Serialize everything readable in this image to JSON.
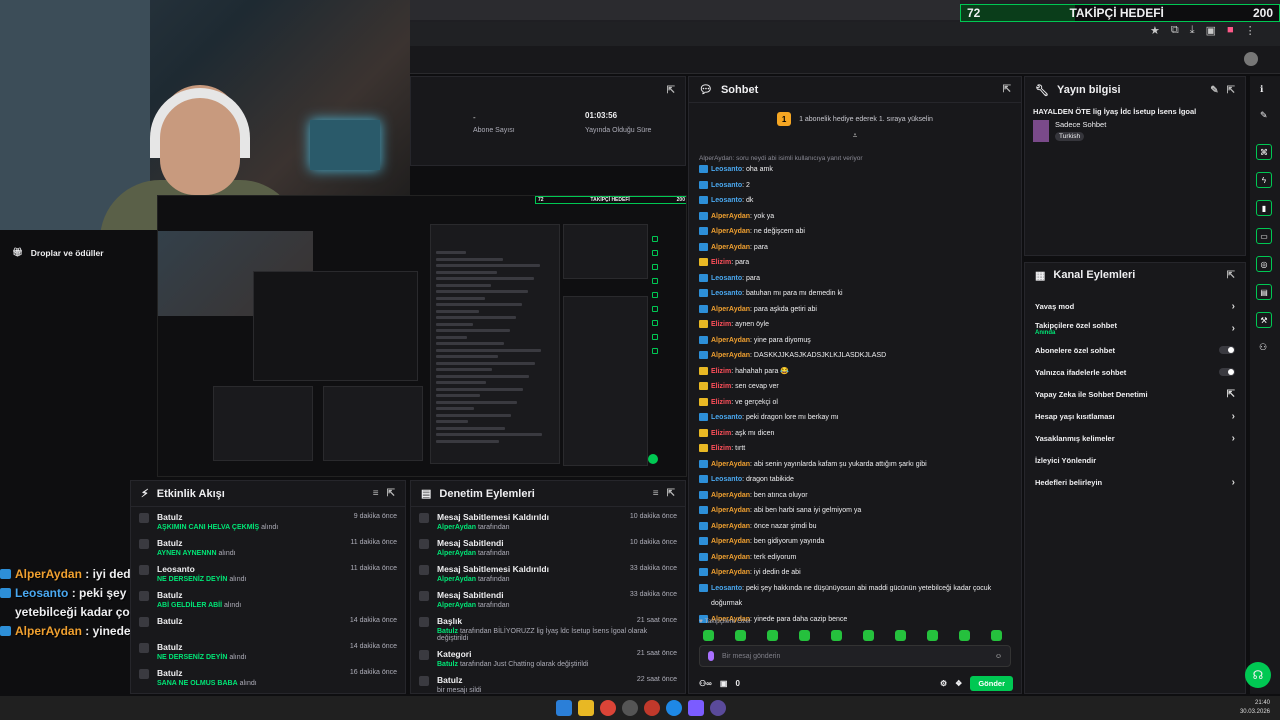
{
  "goal": {
    "current": "72",
    "label": "TAKİPÇİ HEDEFİ",
    "target": "200",
    "progress_fraction": 0.36
  },
  "stats": {
    "dash": "-",
    "subs_label": "Abone Sayısı",
    "live_time": "01:03:56",
    "live_label": "Yayında Olduğu Süre"
  },
  "sidebar": {
    "item_label": "Droplar ve ödüller"
  },
  "left_chat": [
    {
      "user": "AlperAydan",
      "color": "orange",
      "text": ": iyi dedin de abi"
    },
    {
      "user": "Leosanto",
      "color": "blue",
      "text": ": peki şey hakkında ne düşünüyosun abi maddi gücünün yetebilceği kadar çocuk doğurmak"
    },
    {
      "user": "AlperAydan",
      "color": "orange",
      "text": ": yinede para daha cazip bence"
    }
  ],
  "activity": {
    "title": "Etkinlik Akışı",
    "items": [
      {
        "user": "Batulz",
        "reward": "AŞKIMIN CANI HELVA ÇEKMİŞ",
        "suffix": "alındı",
        "time": "9 dakika önce"
      },
      {
        "user": "Batulz",
        "reward": "AYNEN AYNENNN",
        "suffix": "alındı",
        "time": "11 dakika önce"
      },
      {
        "user": "Leosanto",
        "reward": "NE DERSENİZ DEYİN",
        "suffix": "alındı",
        "time": "11 dakika önce"
      },
      {
        "user": "Batulz",
        "reward": "ABİ GELDİLER ABİİ",
        "suffix": "alındı",
        "time": ""
      },
      {
        "user": "Batulz",
        "reward": "",
        "suffix": "",
        "time": "14 dakika önce"
      },
      {
        "user": "Batulz",
        "reward": "NE DERSENİZ DEYİN",
        "suffix": "alındı",
        "time": "14 dakika önce"
      },
      {
        "user": "Batulz",
        "reward": "SANA NE OLMUS BABA",
        "suffix": "alındı",
        "time": "16 dakika önce"
      }
    ]
  },
  "mod": {
    "title": "Denetim Eylemleri",
    "items": [
      {
        "action": "Mesaj Sabitlemesi Kaldırıldı",
        "by": "AlperAydan",
        "by_suffix": "tarafından",
        "time": "10 dakika önce"
      },
      {
        "action": "Mesaj Sabitlendi",
        "by": "AlperAydan",
        "by_suffix": "tarafından",
        "time": "10 dakika önce"
      },
      {
        "action": "Mesaj Sabitlemesi Kaldırıldı",
        "by": "AlperAydan",
        "by_suffix": "tarafından",
        "time": "33 dakika önce"
      },
      {
        "action": "Mesaj Sabitlendi",
        "by": "AlperAydan",
        "by_suffix": "tarafından",
        "time": "33 dakika önce"
      },
      {
        "action": "Başlık",
        "by": "Batulz",
        "by_suffix": "tarafından BİLİYORUZZ lig İyaş ldc İsetup İsens İgoal olarak değiştirildi",
        "time": "21 saat önce"
      },
      {
        "action": "Kategori",
        "by": "Batulz",
        "by_suffix": "tarafından Just Chatting olarak değiştirildi",
        "time": "21 saat önce"
      },
      {
        "action": "Batulz",
        "by": "",
        "by_suffix": "bir mesajı sildi",
        "time": "22 saat önce"
      }
    ]
  },
  "chat": {
    "title": "Sohbet",
    "pinned_count": "1",
    "pinned_text": "1 abonelik hediye ederek 1. sıraya yükselin",
    "reply_note": "AlperAydan: soru neydi abi isimli kullanıcıya yanıt veriyor",
    "messages": [
      {
        "u": "Leosanto",
        "c": "b",
        "t": ": oha amk"
      },
      {
        "u": "Leosanto",
        "c": "b",
        "t": ": 2"
      },
      {
        "u": "Leosanto",
        "c": "b",
        "t": ": dk"
      },
      {
        "u": "AlperAydan",
        "c": "o",
        "t": ": yok ya"
      },
      {
        "u": "AlperAydan",
        "c": "o",
        "t": ": ne değişcem abi"
      },
      {
        "u": "AlperAydan",
        "c": "o",
        "t": ": para"
      },
      {
        "u": "Elizim",
        "c": "r",
        "t": ": para"
      },
      {
        "u": "Leosanto",
        "c": "b",
        "t": ": para"
      },
      {
        "u": "Leosanto",
        "c": "b",
        "t": ": batuhan mı para mı demedin ki"
      },
      {
        "u": "AlperAydan",
        "c": "o",
        "t": ": para aşkda getiri abi"
      },
      {
        "u": "Elizim",
        "c": "r",
        "t": ": aynen öyle"
      },
      {
        "u": "AlperAydan",
        "c": "o",
        "t": ": yine para diyomuş"
      },
      {
        "u": "AlperAydan",
        "c": "o",
        "t": ": DASKKJJKASJKADSJKLKJLASDKJLASD"
      },
      {
        "u": "Elizim",
        "c": "r",
        "t": ": hahahah para 😂"
      },
      {
        "u": "Elizim",
        "c": "r",
        "t": ": sen cevap ver"
      },
      {
        "u": "Elizim",
        "c": "r",
        "t": ": ve gerçekçi ol"
      },
      {
        "u": "Leosanto",
        "c": "b",
        "t": ": peki dragon lore mı berkay mı"
      },
      {
        "u": "Elizim",
        "c": "r",
        "t": ": aşk mı dicen"
      },
      {
        "u": "Elizim",
        "c": "r",
        "t": ": tırtt"
      },
      {
        "u": "AlperAydan",
        "c": "o",
        "t": ": abi senin yayınlarda kafam şu yukarda attığım şarkı gibi"
      },
      {
        "u": "Leosanto",
        "c": "b",
        "t": ": dragon tabikide"
      },
      {
        "u": "AlperAydan",
        "c": "o",
        "t": ": ben atınca oluyor"
      },
      {
        "u": "AlperAydan",
        "c": "o",
        "t": ": abi ben harbi sana iyi gelmiyom ya"
      },
      {
        "u": "AlperAydan",
        "c": "o",
        "t": ": önce nazar şimdi bu"
      },
      {
        "u": "AlperAydan",
        "c": "o",
        "t": ": ben gidiyorum yayında"
      },
      {
        "u": "AlperAydan",
        "c": "o",
        "t": ": terk ediyorum"
      },
      {
        "u": "AlperAydan",
        "c": "o",
        "t": ": iyi dedin de abi"
      },
      {
        "u": "Leosanto",
        "c": "b",
        "t": ": peki şey hakkında ne düşünüyosun abi maddi gücünün yetebilceği kadar çocuk doğurmak"
      },
      {
        "u": "AlperAydan",
        "c": "o",
        "t": ": yinede para daha cazip bence"
      }
    ],
    "followers_only": "Takipçilere Özel",
    "input_placeholder": "Bir mesaj gönderin",
    "points": "0",
    "send_label": "Gönder"
  },
  "info": {
    "title": "Yayın bilgisi",
    "stream_title": "HAYALDEN ÖTE lig İyaş İdc İsetup İsens İgoal",
    "category": "Sadece Sohbet",
    "tag": "Turkish"
  },
  "actions": {
    "title": "Kanal Eylemleri",
    "items": [
      {
        "label": "Yavaş mod",
        "kind": "arrow",
        "sub": ""
      },
      {
        "label": "Takipçilere özel sohbet",
        "kind": "arrow",
        "sub": "Anında"
      },
      {
        "label": "Abonelere özel sohbet",
        "kind": "toggle",
        "sub": ""
      },
      {
        "label": "Yalnızca ifadelerle sohbet",
        "kind": "toggle",
        "sub": ""
      },
      {
        "label": "Yapay Zeka ile Sohbet Denetimi",
        "kind": "ext",
        "sub": ""
      },
      {
        "label": "Hesap yaşı kısıtlaması",
        "kind": "arrow",
        "sub": ""
      },
      {
        "label": "Yasaklanmış kelimeler",
        "kind": "arrow",
        "sub": ""
      },
      {
        "label": "İzleyici Yönlendir",
        "kind": "none",
        "sub": ""
      },
      {
        "label": "Hedefleri belirleyin",
        "kind": "arrow",
        "sub": ""
      }
    ]
  },
  "taskbar": {
    "time": "21:40",
    "date": "30.03.2026"
  },
  "colors": {
    "accent": "#00c853",
    "brand_purple": "#a970ff",
    "orange_user": "#f0a030",
    "blue_user": "#4aa8f0",
    "red_user": "#ff4f5a"
  }
}
